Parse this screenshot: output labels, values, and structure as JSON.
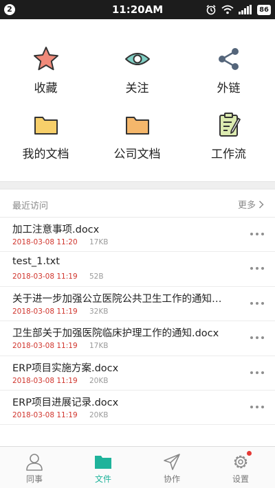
{
  "status_bar": {
    "notification_count": "2",
    "time": "11:20AM",
    "battery": "86",
    "icons": [
      "alarm-icon",
      "wifi-icon",
      "signal-icon"
    ]
  },
  "shortcuts": [
    {
      "label": "收藏",
      "icon": "star-icon",
      "color": "#f08a7a"
    },
    {
      "label": "关注",
      "icon": "eye-icon",
      "color": "#7fcfc4"
    },
    {
      "label": "外链",
      "icon": "share-icon",
      "color": "#54657a"
    },
    {
      "label": "我的文档",
      "icon": "folder-icon",
      "color": "#f7cf6a"
    },
    {
      "label": "公司文档",
      "icon": "folder-icon",
      "color": "#f5b76b"
    },
    {
      "label": "工作流",
      "icon": "clipboard-icon",
      "color": "#dcebb0"
    }
  ],
  "recent": {
    "title": "最近访问",
    "more_label": "更多",
    "files": [
      {
        "name": "加工注意事项.docx",
        "date": "2018-03-08 11:20",
        "size": "17KB"
      },
      {
        "name": "test_1.txt",
        "date": "2018-03-08 11:19",
        "size": "52B"
      },
      {
        "name": "关于进一步加强公立医院公共卫生工作的通知…",
        "date": "2018-03-08 11:19",
        "size": "32KB"
      },
      {
        "name": "卫生部关于加强医院临床护理工作的通知.docx",
        "date": "2018-03-08 11:19",
        "size": "17KB"
      },
      {
        "name": "ERP项目实施方案.docx",
        "date": "2018-03-08 11:19",
        "size": "20KB"
      },
      {
        "name": "ERP项目进展记录.docx",
        "date": "2018-03-08 11:19",
        "size": "20KB"
      }
    ]
  },
  "tabs": [
    {
      "label": "同事",
      "icon": "person-icon",
      "active": false
    },
    {
      "label": "文件",
      "icon": "folder-icon",
      "active": true
    },
    {
      "label": "协作",
      "icon": "send-icon",
      "active": false
    },
    {
      "label": "设置",
      "icon": "gear-icon",
      "active": false
    }
  ],
  "colors": {
    "accent": "#1fb39b",
    "date_red": "#d0342c",
    "badge_red": "#e53935"
  }
}
